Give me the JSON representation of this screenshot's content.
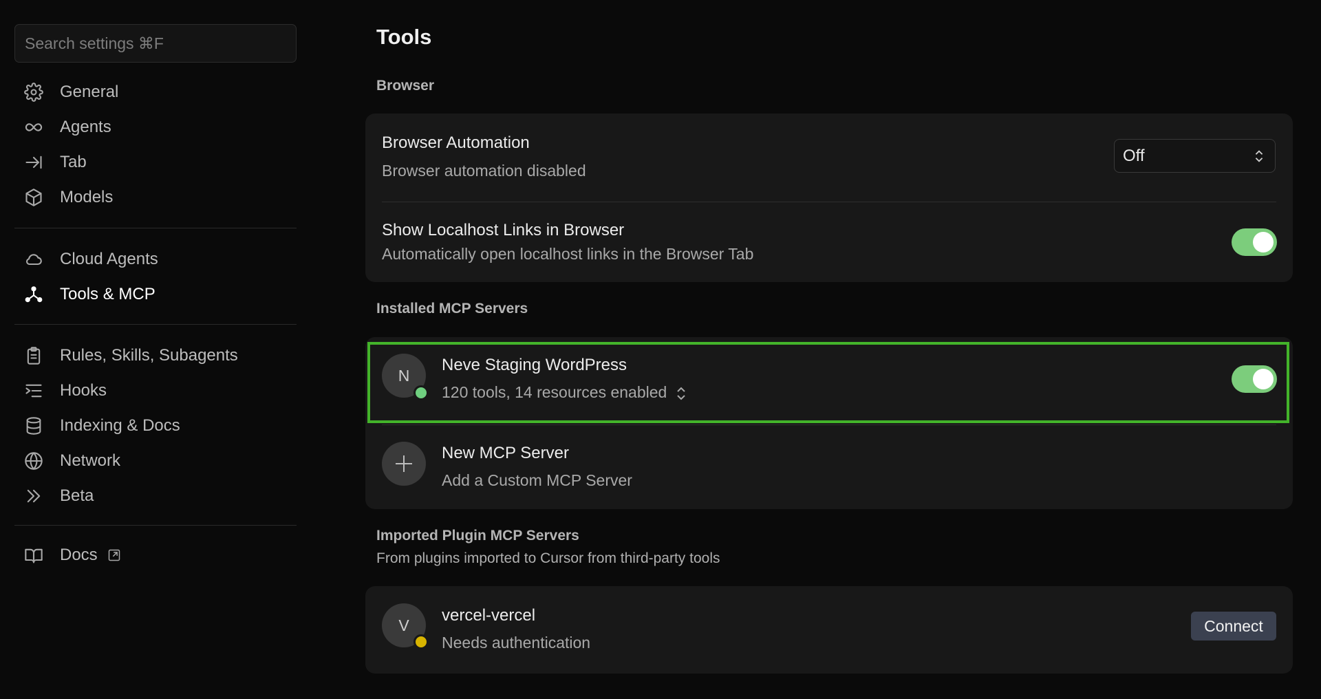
{
  "sidebar": {
    "search_placeholder": "Search settings ⌘F",
    "group1": [
      {
        "label": "General",
        "icon": "gear-icon"
      },
      {
        "label": "Agents",
        "icon": "infinity-icon"
      },
      {
        "label": "Tab",
        "icon": "tab-arrow-icon"
      },
      {
        "label": "Models",
        "icon": "cube-icon"
      }
    ],
    "group2": [
      {
        "label": "Cloud Agents",
        "icon": "cloud-icon"
      },
      {
        "label": "Tools & MCP",
        "icon": "nodes-icon",
        "active": true
      }
    ],
    "group3": [
      {
        "label": "Rules, Skills, Subagents",
        "icon": "clipboard-icon"
      },
      {
        "label": "Hooks",
        "icon": "list-arrow-icon"
      },
      {
        "label": "Indexing & Docs",
        "icon": "database-icon"
      },
      {
        "label": "Network",
        "icon": "globe-icon"
      },
      {
        "label": "Beta",
        "icon": "double-chevron-icon"
      }
    ],
    "group4": [
      {
        "label": "Docs",
        "icon": "book-icon"
      }
    ]
  },
  "main": {
    "title": "Tools",
    "browser": {
      "section_label": "Browser",
      "automation_title": "Browser Automation",
      "automation_sub": "Browser automation disabled",
      "automation_select_value": "Off",
      "localhost_title": "Show Localhost Links in Browser",
      "localhost_sub": "Automatically open localhost links in the Browser Tab",
      "localhost_enabled": true
    },
    "installed": {
      "section_label": "Installed MCP Servers",
      "servers": [
        {
          "initial": "N",
          "name": "Neve Staging WordPress",
          "summary": "120 tools, 14 resources enabled",
          "status_color": "#6fcf7f",
          "enabled": true
        }
      ],
      "new_title": "New MCP Server",
      "new_sub": "Add a Custom MCP Server"
    },
    "imported": {
      "section_label": "Imported Plugin MCP Servers",
      "section_desc": "From plugins imported to Cursor from third-party tools",
      "servers": [
        {
          "initial": "V",
          "name": "vercel-vercel",
          "summary": "Needs authentication",
          "status_color": "#d8b400",
          "action_label": "Connect"
        }
      ]
    }
  },
  "colors": {
    "toggle_on": "#7ccd7c",
    "highlight_border": "#43b32a",
    "background": "#0a0a0a",
    "card": "#181818"
  }
}
